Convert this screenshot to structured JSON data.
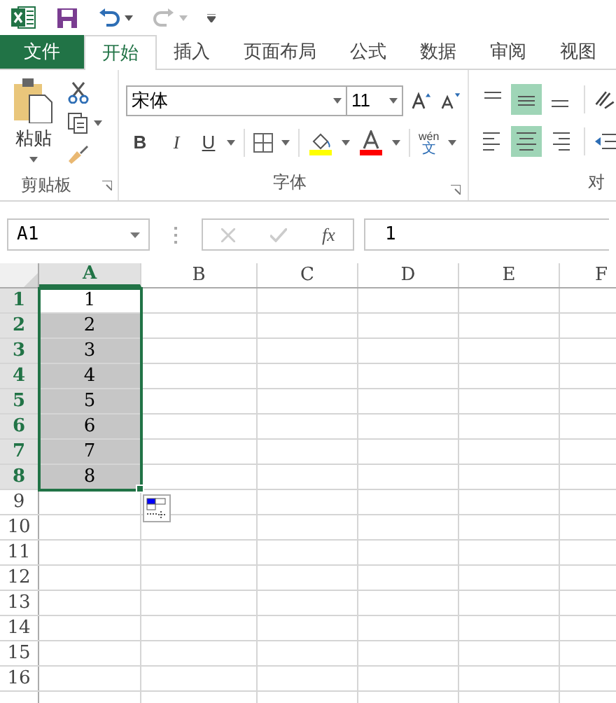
{
  "tabs": [
    {
      "label": "文件",
      "kind": "file",
      "selected": false
    },
    {
      "label": "开始",
      "kind": "tab",
      "selected": true
    },
    {
      "label": "插入",
      "kind": "tab",
      "selected": false
    },
    {
      "label": "页面布局",
      "kind": "tab",
      "selected": false
    },
    {
      "label": "公式",
      "kind": "tab",
      "selected": false
    },
    {
      "label": "数据",
      "kind": "tab",
      "selected": false
    },
    {
      "label": "审阅",
      "kind": "tab",
      "selected": false
    },
    {
      "label": "视图",
      "kind": "tab",
      "selected": false
    }
  ],
  "ribbon": {
    "clipboard": {
      "paste_label": "粘贴",
      "group_label": "剪贴板"
    },
    "font": {
      "font_name": "宋体",
      "font_size": "11",
      "bold": "B",
      "italic": "I",
      "underline": "U",
      "phonetic_top": "wén",
      "phonetic_bottom": "文",
      "group_label": "字体"
    },
    "alignment": {
      "group_label": "对",
      "vertical": [
        {
          "selected": false
        },
        {
          "selected": true
        },
        {
          "selected": false
        }
      ],
      "horizontal": [
        {
          "selected": false
        },
        {
          "selected": true
        },
        {
          "selected": false
        }
      ]
    }
  },
  "formula_bar": {
    "name_box": "A1",
    "fx": "fx",
    "formula": "1"
  },
  "grid": {
    "columns": [
      {
        "label": "A",
        "selected": true
      },
      {
        "label": "B",
        "selected": false
      },
      {
        "label": "C",
        "selected": false
      },
      {
        "label": "D",
        "selected": false
      },
      {
        "label": "E",
        "selected": false
      },
      {
        "label": "F",
        "selected": false
      }
    ],
    "rows": [
      {
        "label": "1",
        "selected": true,
        "cells": [
          {
            "value": "1",
            "active": true
          }
        ]
      },
      {
        "label": "2",
        "selected": true,
        "cells": [
          {
            "value": "2",
            "active": false
          }
        ]
      },
      {
        "label": "3",
        "selected": true,
        "cells": [
          {
            "value": "3",
            "active": false
          }
        ]
      },
      {
        "label": "4",
        "selected": true,
        "cells": [
          {
            "value": "4",
            "active": false
          }
        ]
      },
      {
        "label": "5",
        "selected": true,
        "cells": [
          {
            "value": "5",
            "active": false
          }
        ]
      },
      {
        "label": "6",
        "selected": true,
        "cells": [
          {
            "value": "6",
            "active": false
          }
        ]
      },
      {
        "label": "7",
        "selected": true,
        "cells": [
          {
            "value": "7",
            "active": false
          }
        ]
      },
      {
        "label": "8",
        "selected": true,
        "cells": [
          {
            "value": "8",
            "active": false
          }
        ]
      },
      {
        "label": "9",
        "selected": false,
        "cells": []
      },
      {
        "label": "10",
        "selected": false,
        "cells": []
      },
      {
        "label": "11",
        "selected": false,
        "cells": []
      },
      {
        "label": "12",
        "selected": false,
        "cells": []
      },
      {
        "label": "13",
        "selected": false,
        "cells": []
      },
      {
        "label": "14",
        "selected": false,
        "cells": []
      },
      {
        "label": "15",
        "selected": false,
        "cells": []
      },
      {
        "label": "16",
        "selected": false,
        "cells": []
      }
    ]
  }
}
